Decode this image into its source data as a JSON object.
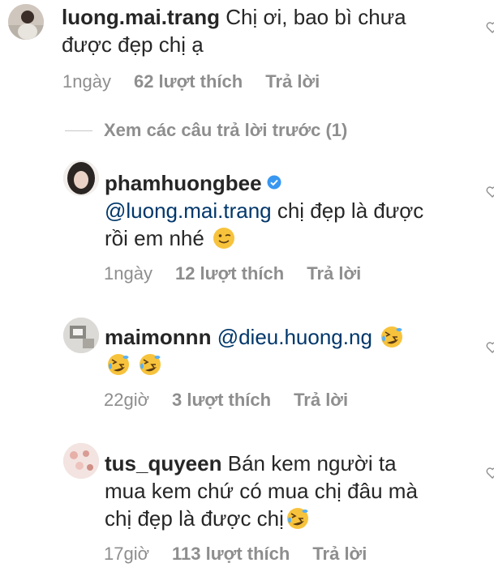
{
  "comments": [
    {
      "username": "luong.mai.trang",
      "text_line1": " Chị ơi, bao bì chưa",
      "text_line2": "được đẹp chị ạ",
      "time": "1ngày",
      "likes": "62 lượt thích",
      "reply": "Trả lời"
    }
  ],
  "view_previous": "Xem các câu trả lời trước (1)",
  "replies": [
    {
      "username": "phamhuongbee",
      "verified": true,
      "mention": "@luong.mai.trang",
      "text_line1": " chị đẹp là được",
      "text_line2": "rồi em nhé ",
      "emoji": "winking-face",
      "time": "1ngày",
      "likes": "12 lượt thích",
      "reply": "Trả lời"
    },
    {
      "username": "maimonnn",
      "mention": "@dieu.huong.ng",
      "emoji": "rolling-on-floor-laughing",
      "time": "22giờ",
      "likes": "3 lượt thích",
      "reply": "Trả lời"
    },
    {
      "username": "tus_quyeen",
      "text_line1": " Bán kem người ta",
      "text_line2": "mua kem chứ có mua chị đâu mà",
      "text_line3": "chị đẹp là được chị",
      "emoji": "rolling-on-floor-laughing",
      "time": "17giờ",
      "likes": "113 lượt thích",
      "reply": "Trả lời"
    }
  ],
  "colors": {
    "text": "#262626",
    "secondary": "#8e8e8e",
    "mention": "#00376b",
    "verified": "#3897f0",
    "emoji_face": "#f7c33c"
  }
}
